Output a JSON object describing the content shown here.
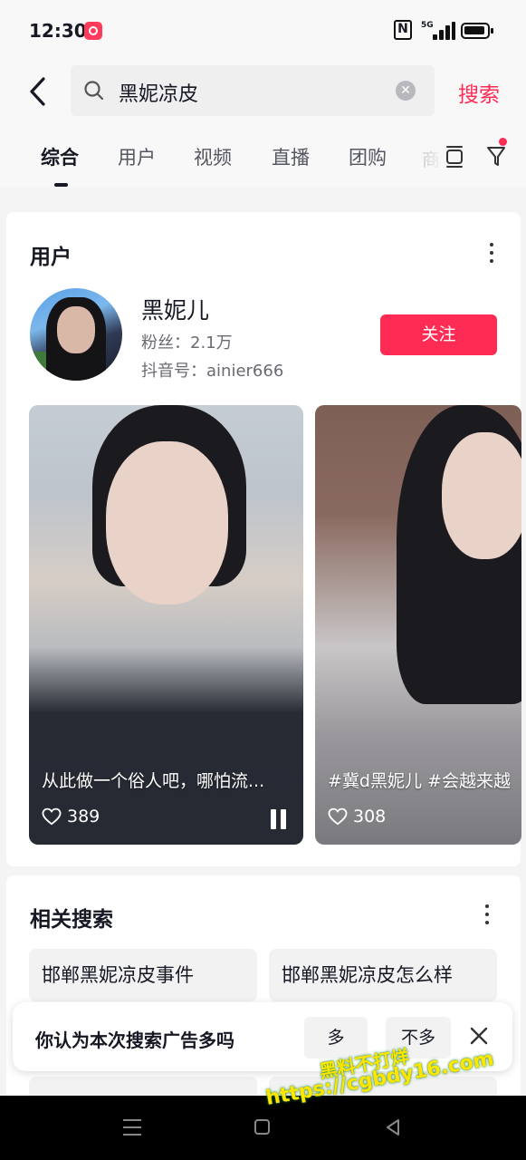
{
  "status_bar": {
    "time": "12:30",
    "nfc_label": "N",
    "network_label": "5G",
    "icons": [
      "app-notification-icon",
      "nfc-icon",
      "signal-icon",
      "battery-icon"
    ]
  },
  "search": {
    "query": "黑妮凉皮",
    "submit_label": "搜索",
    "clear_icon": "clear-icon",
    "accent": "#fe2c55"
  },
  "tabs": [
    {
      "label": "综合",
      "active": true
    },
    {
      "label": "用户",
      "active": false
    },
    {
      "label": "视频",
      "active": false
    },
    {
      "label": "直播",
      "active": false
    },
    {
      "label": "团购",
      "active": false
    }
  ],
  "tab_overflow": "商",
  "user_section": {
    "title": "用户",
    "user": {
      "name": "黑妮儿",
      "fans": "粉丝：2.1万",
      "douyin_id": "抖音号：ainier666",
      "follow_label": "关注"
    },
    "videos": [
      {
        "caption": "从此做一个俗人吧，哪怕流...",
        "likes": "389",
        "playing": true
      },
      {
        "caption": "#冀d黑妮儿 #会越来越",
        "likes": "308",
        "playing": false
      }
    ]
  },
  "related_section": {
    "title": "相关搜索",
    "items": [
      "邯郸黑妮凉皮事件",
      "邯郸黑妮凉皮怎么样"
    ]
  },
  "ad_feedback": {
    "question": "你认为本次搜索广告多吗",
    "options": [
      "多",
      "不多"
    ]
  },
  "watermark": {
    "line1": "黑料不打烊",
    "line2": "https://cgbdy16.com",
    "color": "#ffe600"
  }
}
